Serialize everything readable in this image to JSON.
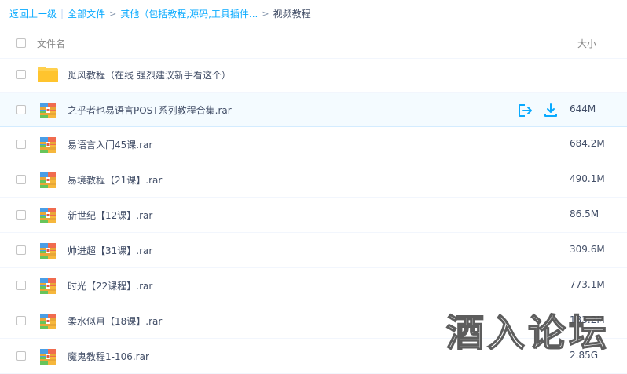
{
  "breadcrumb": {
    "back": "返回上一级",
    "separator": "|",
    "all_files": "全部文件",
    "arrow": ">",
    "others": "其他（包括教程,源码,工具插件...",
    "current": "视频教程"
  },
  "header": {
    "name_label": "文件名",
    "size_label": "大小"
  },
  "files": [
    {
      "name": "觅风教程（在线 强烈建议新手看这个）",
      "size": "-",
      "type": "folder"
    },
    {
      "name": "之乎者也易语言POST系列教程合集.rar",
      "size": "644M",
      "type": "rar"
    },
    {
      "name": "易语言入门45课.rar",
      "size": "684.2M",
      "type": "rar"
    },
    {
      "name": "易境教程【21课】.rar",
      "size": "490.1M",
      "type": "rar"
    },
    {
      "name": "新世纪【12课】.rar",
      "size": "86.5M",
      "type": "rar"
    },
    {
      "name": "帅进超【31课】.rar",
      "size": "309.6M",
      "type": "rar"
    },
    {
      "name": "时光【22课程】.rar",
      "size": "773.1M",
      "type": "rar"
    },
    {
      "name": "柔水似月【18课】.rar",
      "size": "183.2M",
      "type": "rar"
    },
    {
      "name": "魔鬼教程1-106.rar",
      "size": "2.85G",
      "type": "rar"
    }
  ],
  "icons": {
    "folder": "folder-icon",
    "archive": "rar-archive-icon",
    "share": "share-icon",
    "download": "download-icon"
  },
  "colors": {
    "accent": "#09aaff",
    "folder": "#ffd04d",
    "hover_bg": "#f4fbff"
  },
  "watermark": "酒入论坛"
}
